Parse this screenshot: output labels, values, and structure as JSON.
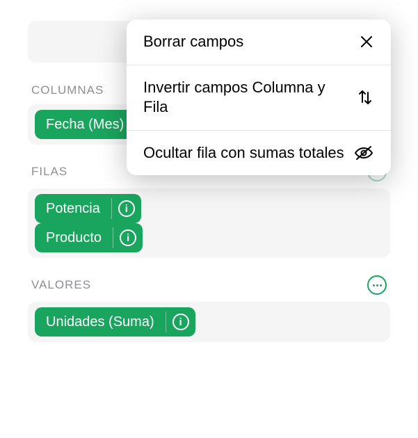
{
  "popover": {
    "items": [
      {
        "label": "Borrar campos",
        "icon": "close"
      },
      {
        "label": "Invertir campos Columna y Fila",
        "icon": "swap"
      },
      {
        "label": "Ocultar fila con sumas totales",
        "icon": "hide"
      }
    ]
  },
  "sections": {
    "columnas": {
      "label": "COLUMNAS",
      "chips": [
        {
          "label": "Fecha (Mes)"
        }
      ]
    },
    "filas": {
      "label": "FILAS",
      "chips": [
        {
          "label": "Potencia"
        },
        {
          "label": "Producto"
        }
      ]
    },
    "valores": {
      "label": "VALORES",
      "chips": [
        {
          "label": "Unidades (Suma)"
        }
      ]
    }
  }
}
